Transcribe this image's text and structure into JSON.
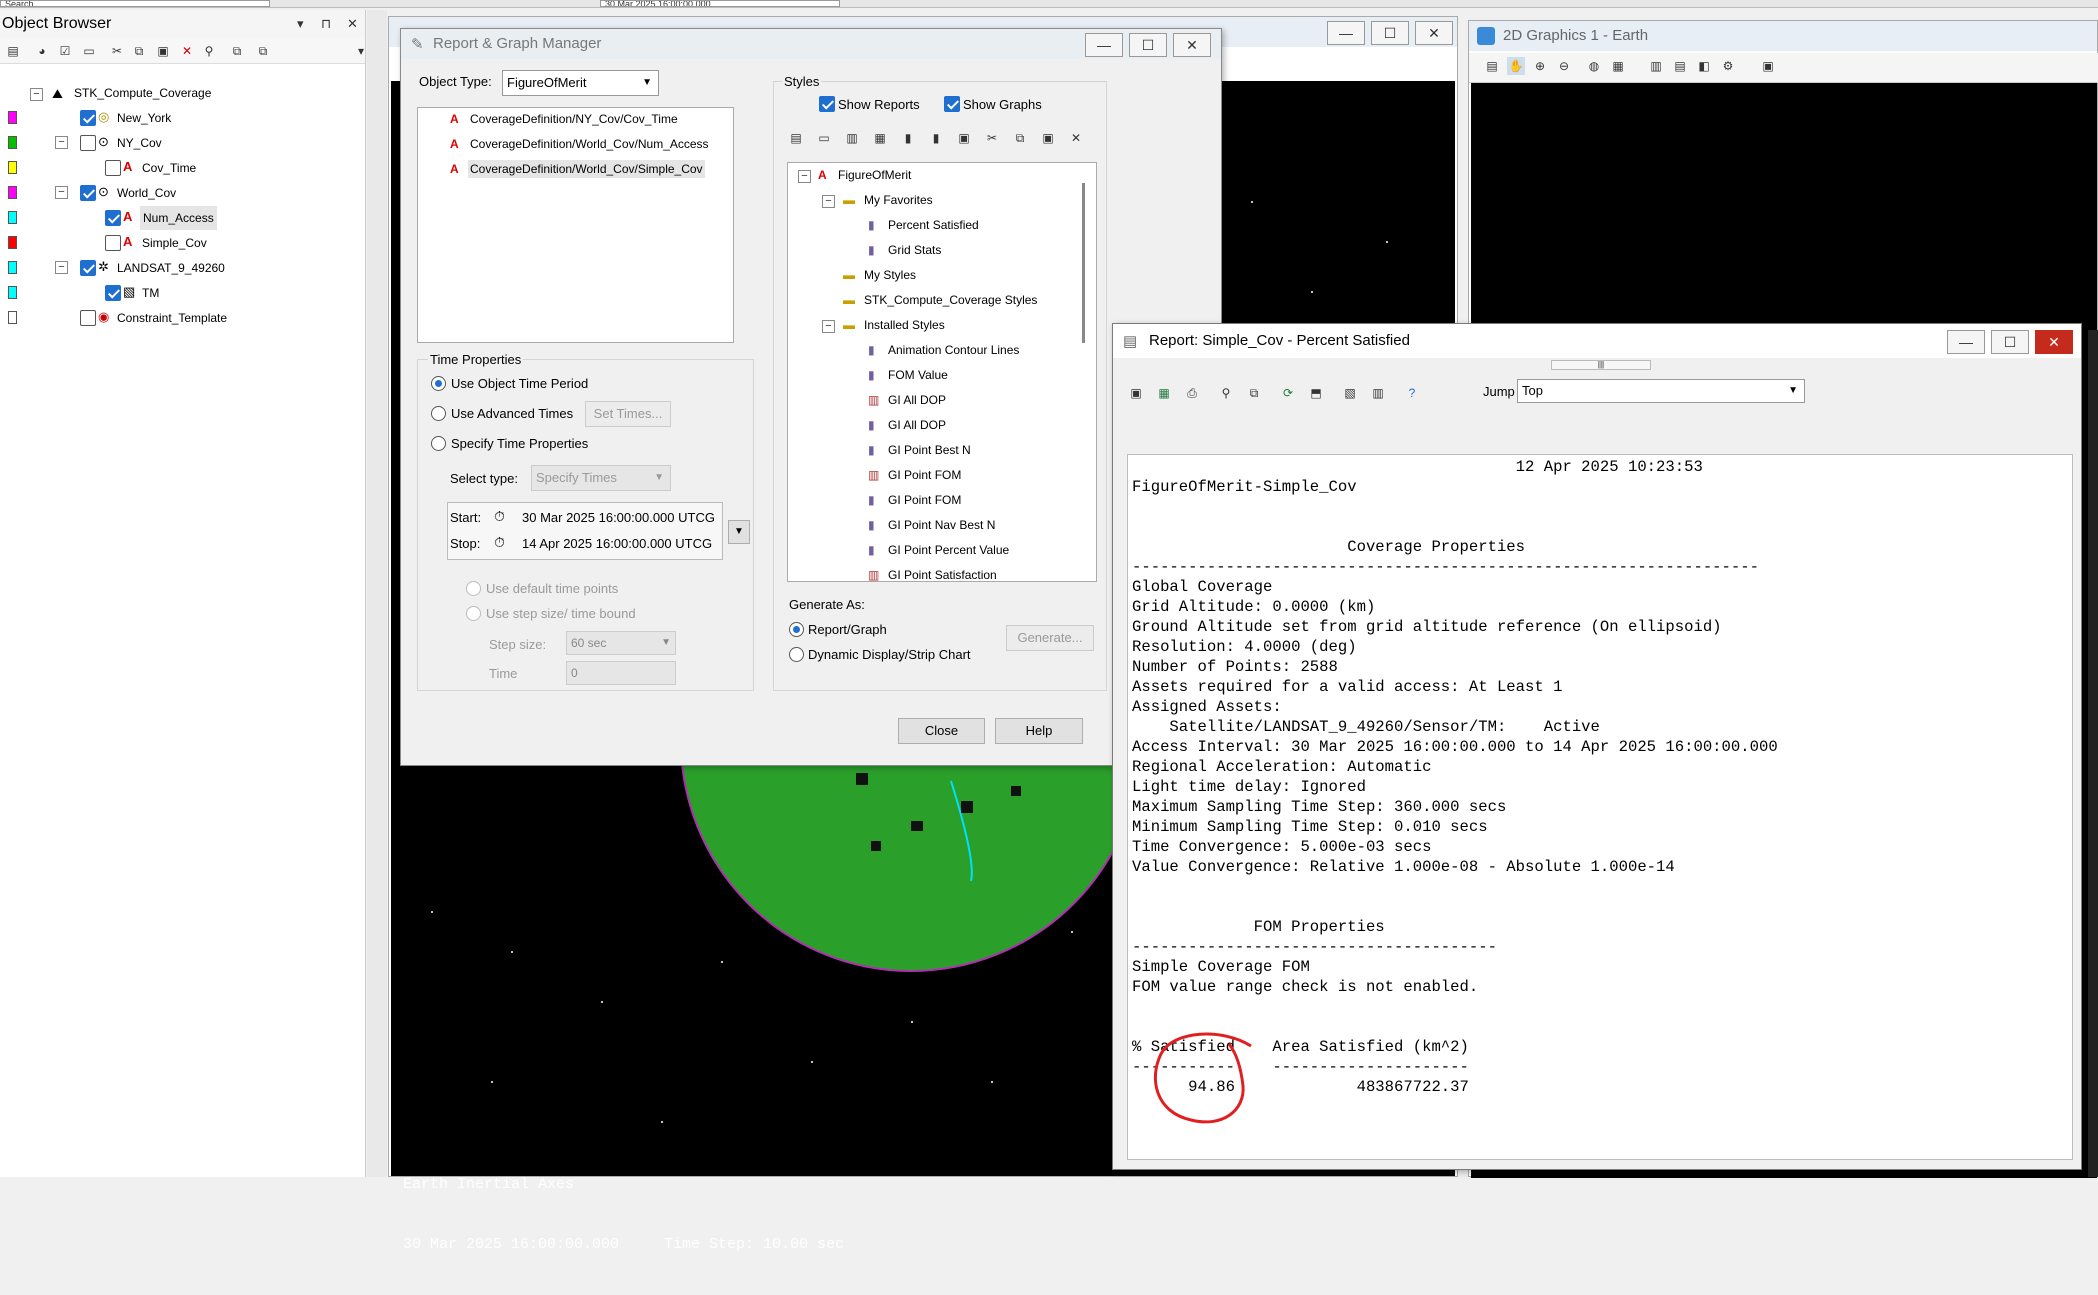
{
  "top_strip": {
    "left_text": "Search",
    "time_text": "30 Mar 2025 16:00:00.000"
  },
  "object_browser": {
    "title": "Object Browser",
    "ctrl_pin": "▾",
    "ctrl_dock": "⊓",
    "ctrl_close": "✕",
    "tree": [
      {
        "label": "STK_Compute_Coverage",
        "color": ""
      },
      {
        "label": "New_York",
        "color": "#ff00ff"
      },
      {
        "label": "NY_Cov",
        "color": "#00c000"
      },
      {
        "label": "Cov_Time",
        "color": "#ffff00"
      },
      {
        "label": "World_Cov",
        "color": "#ff00ff"
      },
      {
        "label": "Num_Access",
        "color": "#00ffff"
      },
      {
        "label": "Simple_Cov",
        "color": "#ff0000"
      },
      {
        "label": "LANDSAT_9_49260",
        "color": "#00ffff"
      },
      {
        "label": "TM",
        "color": "#00ffff"
      },
      {
        "label": "Constraint_Template",
        "color": "#ffffff"
      }
    ]
  },
  "graphics_3d": {
    "overlay_line1": "Earth Inertial Axes",
    "overlay_line2": "30 Mar 2025 16:00:00.000     Time Step: 10.00 sec"
  },
  "graphics_2d": {
    "title": "2D Graphics 1 - Earth"
  },
  "rgm": {
    "title": "Report & Graph Manager",
    "object_type_label": "Object Type:",
    "object_type_value": "FigureOfMerit",
    "objects": [
      "CoverageDefinition/NY_Cov/Cov_Time",
      "CoverageDefinition/World_Cov/Num_Access",
      "CoverageDefinition/World_Cov/Simple_Cov"
    ],
    "time_props": {
      "title": "Time Properties",
      "use_object": "Use Object Time Period",
      "use_advanced": "Use Advanced Times",
      "set_times": "Set Times...",
      "specify": "Specify Time Properties",
      "select_type_label": "Select type:",
      "select_type_value": "Specify Times",
      "start_label": "Start:",
      "start_value": "30 Mar 2025 16:00:00.000 UTCG",
      "stop_label": "Stop:",
      "stop_value": "14 Apr 2025 16:00:00.000 UTCG",
      "use_default_points": "Use default time points",
      "use_step": "Use step size/ time bound",
      "step_label": "Step size:",
      "step_value": "60 sec",
      "time_label": "Time",
      "time_value": "0"
    },
    "styles": {
      "title": "Styles",
      "show_reports": "Show Reports",
      "show_graphs": "Show Graphs",
      "tree": [
        "FigureOfMerit",
        "My Favorites",
        "Percent Satisfied",
        "Grid Stats",
        "My Styles",
        "STK_Compute_Coverage Styles",
        "Installed Styles",
        "Animation Contour Lines",
        "FOM Value",
        "GI All DOP",
        "GI All DOP",
        "GI Point Best N",
        "GI Point FOM",
        "GI Point FOM",
        "GI Point Nav Best N",
        "GI Point Percent Value",
        "GI Point Satisfaction"
      ]
    },
    "generate": {
      "title": "Generate As:",
      "report_graph": "Report/Graph",
      "dynamic": "Dynamic Display/Strip Chart",
      "generate_btn": "Generate..."
    },
    "close_btn": "Close",
    "help_btn": "Help"
  },
  "report": {
    "title": "Report:  Simple_Cov - Percent Satisfied",
    "jump_label": "Jump",
    "jump_value": "Top",
    "body": "                                         12 Apr 2025 10:23:53\nFigureOfMerit-Simple_Cov\n\n\n                       Coverage Properties\n-------------------------------------------------------------------\nGlobal Coverage\nGrid Altitude: 0.0000 (km)\nGround Altitude set from grid altitude reference (On ellipsoid)\nResolution: 4.0000 (deg)\nNumber of Points: 2588\nAssets required for a valid access: At Least 1\nAssigned Assets:\n    Satellite/LANDSAT_9_49260/Sensor/TM:    Active\nAccess Interval: 30 Mar 2025 16:00:00.000 to 14 Apr 2025 16:00:00.000\nRegional Acceleration: Automatic\nLight time delay: Ignored\nMaximum Sampling Time Step: 360.000 secs\nMinimum Sampling Time Step: 0.010 secs\nTime Convergence: 5.000e-03 secs\nValue Convergence: Relative 1.000e-08 - Absolute 1.000e-14\n\n\n             FOM Properties\n---------------------------------------\nSimple Coverage FOM\nFOM value range check is not enabled.\n\n\n% Satisfied    Area Satisfied (km^2)\n-----------    ---------------------\n      94.86             483867722.37"
  },
  "colors": {
    "annotation": "#e02020",
    "globe": "#2aa02a",
    "selection": "#1f6fd0"
  }
}
